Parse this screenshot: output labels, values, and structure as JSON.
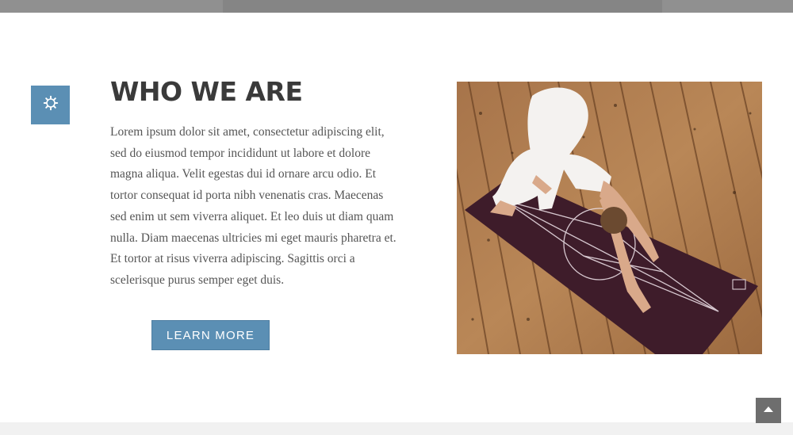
{
  "section": {
    "icon": "gear-icon",
    "title": "WHO WE ARE",
    "paragraph_lines": [
      "Lorem ipsum dolor sit amet, consectetur adipiscing elit,",
      "sed do eiusmod tempor incididunt ut labore et dolore",
      "magna aliqua. Velit egestas dui id ornare arcu odio. Et",
      "tortor consequat id porta nibh venenatis cras. Maecenas",
      "sed enim ut sem viverra aliquet. Et leo duis ut diam quam",
      "nulla. Diam maecenas ultricies mi eget mauris pharetra et.",
      "Et tortor at risus viverra adipiscing. Sagittis orci a",
      "scelerisque purus semper eget duis."
    ],
    "button_label": "LEARN MORE"
  },
  "photo": {
    "subject": "yoga-downward-dog-photo"
  },
  "scroll_top": {
    "icon": "chevron-up-icon"
  },
  "colors": {
    "accent": "#5b8fb4",
    "title": "#3a3a3a",
    "body_text": "#555555",
    "top_bar": "#909090",
    "scroll_button": "#6e6e6e"
  }
}
